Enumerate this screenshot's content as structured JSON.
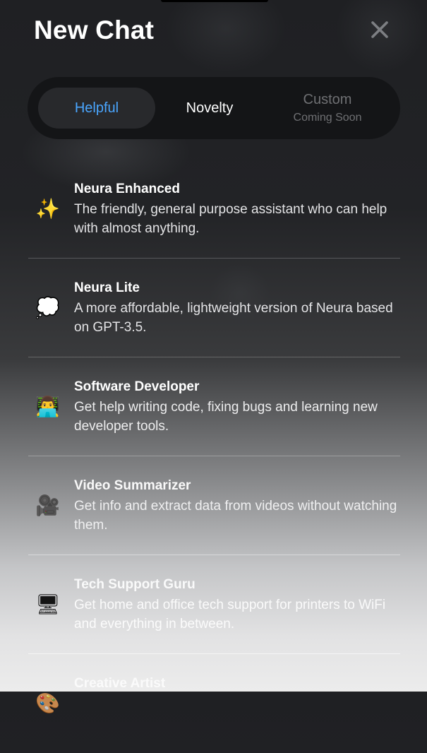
{
  "header": {
    "title": "New Chat"
  },
  "tabs": [
    {
      "label": "Helpful",
      "sub": ""
    },
    {
      "label": "Novelty",
      "sub": ""
    },
    {
      "label": "Custom",
      "sub": "Coming Soon"
    }
  ],
  "colors": {
    "active_tab_text": "#4aa6ff",
    "tabs_bar": "#141517",
    "active_tab_bg": "#28292c"
  },
  "assistants": [
    {
      "icon": "sparkles-icon",
      "glyph": "✨",
      "name": "Neura Enhanced",
      "description": "The friendly, general purpose assistant who can help with almost anything."
    },
    {
      "icon": "thought-bubble-icon",
      "glyph": "💭",
      "name": "Neura Lite",
      "description": "A more affordable, lightweight version of Neura based on GPT-3.5."
    },
    {
      "icon": "technologist-icon",
      "glyph": "👨‍💻",
      "name": "Software Developer",
      "description": "Get help writing code, fixing bugs and learning new developer tools."
    },
    {
      "icon": "movie-camera-icon",
      "glyph": "🎥",
      "name": "Video Summarizer",
      "description": "Get info and extract data from videos without watching them."
    },
    {
      "icon": "desktop-computer-icon",
      "glyph": "🖥",
      "name": "Tech Support Guru",
      "description": "Get home and office tech support for printers to WiFi and everything in between."
    },
    {
      "icon": "palette-icon",
      "glyph": "🎨",
      "name": "Creative Artist",
      "description": ""
    }
  ]
}
